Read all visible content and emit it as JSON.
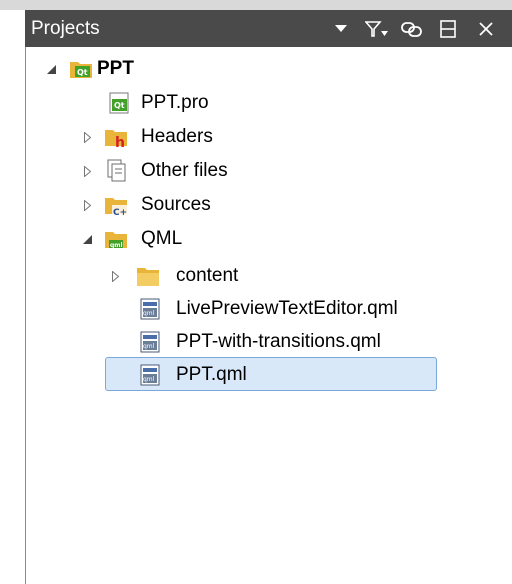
{
  "panel": {
    "title": "Projects",
    "toolbar": [
      "dropdown-arrow-icon",
      "filter-icon",
      "link-icon",
      "split-icon",
      "close-icon"
    ]
  },
  "tree": {
    "root": "PPT",
    "pro_file": "PPT.pro",
    "headers": "Headers",
    "other_files": "Other files",
    "sources": "Sources",
    "qml": "QML",
    "content": "content",
    "file1": "LivePreviewTextEditor.qml",
    "file2": "PPT-with-transitions.qml",
    "file3": "PPT.qml"
  },
  "colors": {
    "header_bg": "#4a4a4a",
    "selection_bg": "#d9e8f9",
    "selection_border": "#7aa7dc",
    "folder": "#e8b43a",
    "qt_green": "#41a128",
    "headers_red": "#d42020"
  }
}
